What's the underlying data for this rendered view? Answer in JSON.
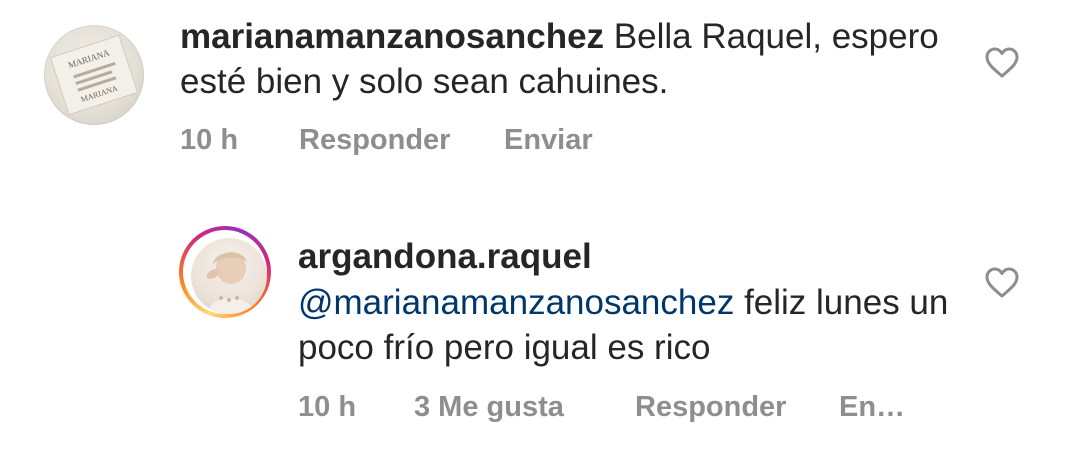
{
  "comments": [
    {
      "username": "marianamanzanosanchez",
      "text": "Bella Raquel, espero esté bien y solo sean cahuines.",
      "time": "10 h",
      "reply_label": "Responder",
      "send_label": "Enviar",
      "avatar_icon": "mariana-logo-avatar",
      "like_icon": "heart-outline-icon"
    }
  ],
  "replies": [
    {
      "username": "argandona.raquel",
      "mention": "@marianamanzanosanchez",
      "text": "feliz lunes un poco frío pero igual es rico",
      "time": "10 h",
      "likes": "3 Me gusta",
      "reply_label": "Responder",
      "send_label_truncated": "En…",
      "avatar_icon": "user-photo-avatar",
      "story_ring": true,
      "like_icon": "heart-outline-icon"
    }
  ],
  "colors": {
    "text": "#262626",
    "meta": "#8e8e8e",
    "mention": "#00376b",
    "heart_stroke": "#8e8e8e"
  }
}
